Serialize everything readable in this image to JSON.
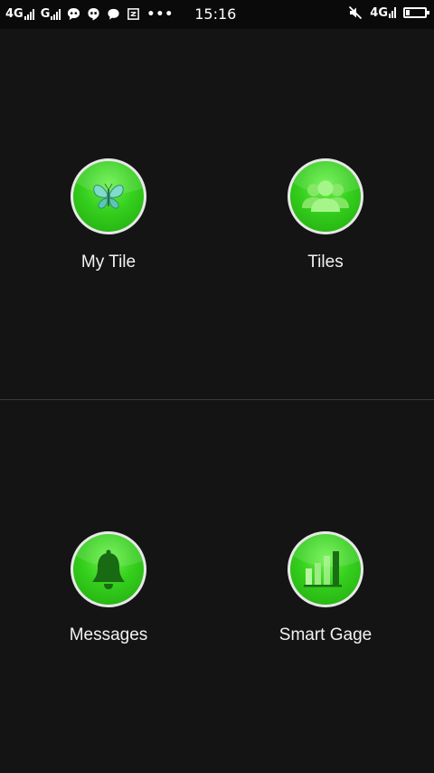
{
  "status_bar": {
    "signal_1": "4G",
    "signal_2": "G",
    "time": "15:16",
    "network_right": "4G",
    "icons": [
      "signal-icon",
      "chat-bubble-icon",
      "hangouts-icon",
      "message-icon",
      "notification-icon",
      "more-dots-icon",
      "mute-icon",
      "battery-icon"
    ],
    "battery_level": 0.2
  },
  "tiles": [
    {
      "label": "My Tile",
      "icon": "butterfly-icon"
    },
    {
      "label": "Tiles",
      "icon": "users-icon"
    },
    {
      "label": "Messages",
      "icon": "bell-icon"
    },
    {
      "label": "Smart Gage",
      "icon": "bar-chart-icon"
    }
  ],
  "colors": {
    "background": "#141414",
    "accent_green": "#35cf1d",
    "circle_border": "#e8e8e8",
    "divider": "#3a3a3a"
  }
}
